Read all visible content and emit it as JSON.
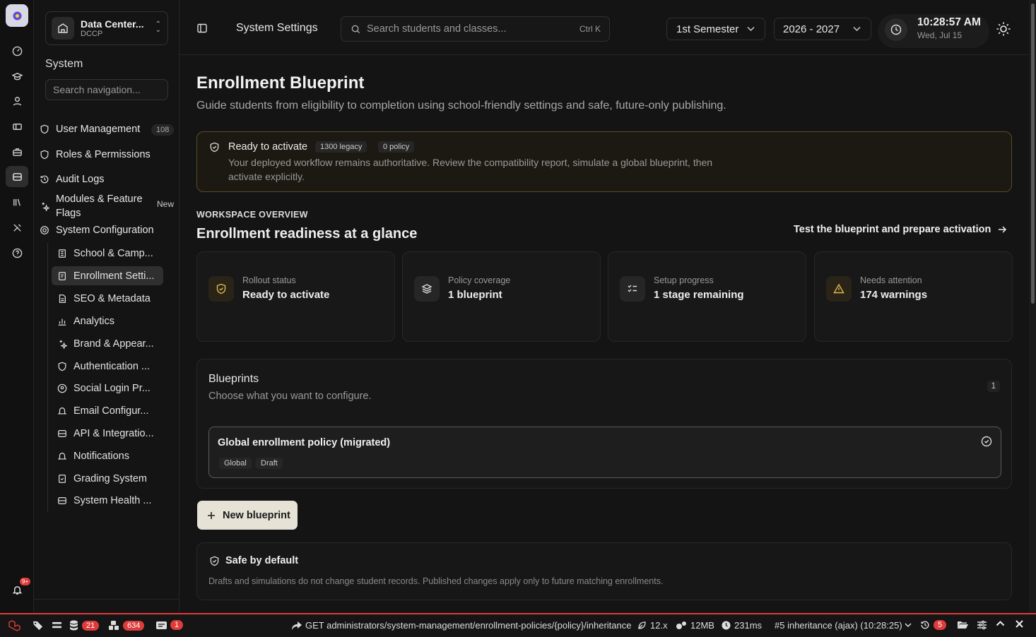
{
  "rail": {
    "items": [
      "dashboard-icon",
      "graduation-cap-icon",
      "user-icon",
      "tickets-icon",
      "briefcase-icon",
      "database-icon",
      "library-icon",
      "tools-icon",
      "help-icon"
    ],
    "notification_count": "9+"
  },
  "sidebar": {
    "org_name": "Data Center...",
    "org_sub": "DCCP",
    "section": "System",
    "search_placeholder": "Search navigation...",
    "items": [
      {
        "label": "User Management",
        "badge": "108"
      },
      {
        "label": "Roles & Permissions"
      },
      {
        "label": "Audit Logs"
      },
      {
        "label": "Modules & Feature Flags",
        "badge": "New"
      },
      {
        "label": "System Configuration"
      }
    ],
    "sub_items": [
      "School & Camp...",
      "Enrollment Setti...",
      "SEO & Metadata",
      "Analytics",
      "Brand & Appear...",
      "Authentication ...",
      "Social Login Pr...",
      "Email Configur...",
      "API & Integratio...",
      "Notifications",
      "Grading System",
      "System Health ..."
    ]
  },
  "topbar": {
    "title": "System Settings",
    "search_placeholder": "Search students and classes...",
    "search_shortcut": "Ctrl K",
    "semester": "1st Semester",
    "year": "2026 - 2027",
    "time": "10:28:57 AM",
    "date": "Wed, Jul 15"
  },
  "page": {
    "title": "Enrollment Blueprint",
    "subtitle": "Guide students from eligibility to completion using school-friendly settings and safe, future-only publishing.",
    "alert": {
      "title": "Ready to activate",
      "chip1": "1300 legacy",
      "chip2": "0 policy",
      "line1": "Your deployed workflow remains authoritative. Review the compatibility report, simulate a global blueprint, then",
      "line2": "activate explicitly."
    },
    "overview_label": "WORKSPACE OVERVIEW",
    "overview_title": "Enrollment readiness at a glance",
    "overview_link": "Test the blueprint and prepare activation",
    "cards": [
      {
        "label": "Rollout status",
        "value": "Ready to activate",
        "icon": "shield-check-icon"
      },
      {
        "label": "Policy coverage",
        "value": "1 blueprint",
        "icon": "layers-icon"
      },
      {
        "label": "Setup progress",
        "value": "1 stage remaining",
        "icon": "checklist-icon"
      },
      {
        "label": "Needs attention",
        "value": "174 warnings",
        "icon": "warning-icon"
      }
    ],
    "blueprints": {
      "title": "Blueprints",
      "subtitle": "Choose what you want to configure.",
      "count": "1",
      "item_title": "Global enrollment policy (migrated)",
      "chip1": "Global",
      "chip2": "Draft"
    },
    "new_button": "New blueprint",
    "safe": {
      "title": "Safe by default",
      "text": "Drafts and simulations do not change student records. Published changes apply only to future matching enrollments."
    }
  },
  "debugbar": {
    "count1": "21",
    "count2": "634",
    "count3": "1",
    "request": "GET administrators/system-management/enrollment-policies/{policy}/inheritance",
    "version": "12.x",
    "memory": "12MB",
    "duration": "231ms",
    "request_id": "#5 inheritance (ajax) (10:28:25)",
    "history_count": "5"
  }
}
